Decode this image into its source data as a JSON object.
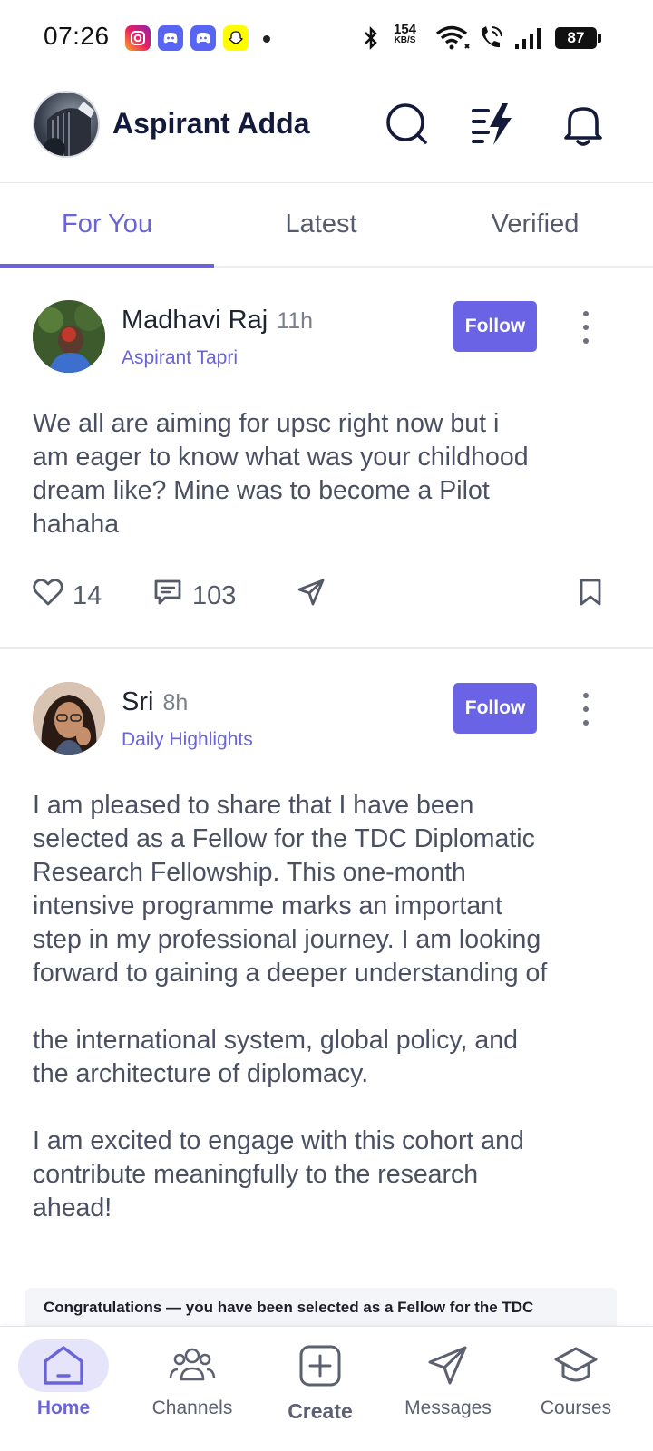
{
  "status_bar": {
    "time": "07:26",
    "net_speed_value": "154",
    "net_speed_unit": "KB/S",
    "battery": "87",
    "notification_icons": [
      "instagram-icon",
      "discord-icon",
      "discord-icon",
      "snapchat-icon"
    ]
  },
  "header": {
    "title": "Aspirant Adda",
    "icons": [
      "search-icon",
      "flash-feed-icon",
      "bell-icon"
    ]
  },
  "tabs": [
    {
      "label": "For You",
      "active": true
    },
    {
      "label": "Latest",
      "active": false
    },
    {
      "label": "Verified",
      "active": false
    }
  ],
  "posts": [
    {
      "author": "Madhavi Raj",
      "time": "11h",
      "channel": "Aspirant Tapri",
      "follow_label": "Follow",
      "text": "We all are aiming for upsc right now but i\nam eager to know what was your childhood\ndream like? Mine was to become a Pilot\nhahaha",
      "likes": "14",
      "comments": "103"
    },
    {
      "author": "Sri",
      "time": "8h",
      "channel": "Daily Highlights",
      "follow_label": "Follow",
      "text": "I am pleased to share that I have been\nselected as a Fellow for the TDC Diplomatic\nResearch Fellowship. This one-month\nintensive programme marks an important\nstep in my professional journey. I am looking\nforward to gaining a deeper understanding of\n\nthe international system, global policy, and\nthe architecture of diplomacy.\n\nI am excited to engage with this cohort and\ncontribute meaningfully to the research\nahead!",
      "preview_text": "Congratulations — you have been selected as a Fellow for the TDC"
    }
  ],
  "bottom_nav": [
    {
      "label": "Home",
      "icon": "home-icon",
      "active": true
    },
    {
      "label": "Channels",
      "icon": "channels-icon",
      "active": false
    },
    {
      "label": "Create",
      "icon": "create-icon",
      "active": false
    },
    {
      "label": "Messages",
      "icon": "messages-icon",
      "active": false
    },
    {
      "label": "Courses",
      "icon": "courses-icon",
      "active": false
    }
  ],
  "colors": {
    "accent": "#6a64d8",
    "follow_button": "#6b63e6",
    "title": "#141a3a"
  }
}
